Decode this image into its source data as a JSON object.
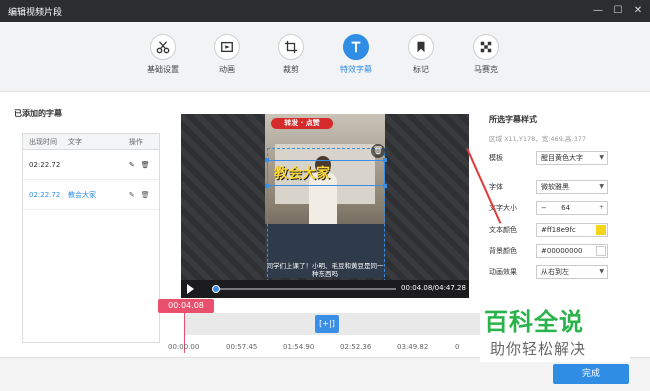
{
  "window": {
    "title": "编辑视频片段",
    "minimize": "—",
    "maximize": "☐",
    "close": "✕"
  },
  "toolbar": {
    "tools": [
      {
        "label": "基础设置",
        "icon": "scissors-icon"
      },
      {
        "label": "动画",
        "icon": "film-icon"
      },
      {
        "label": "裁剪",
        "icon": "crop-icon"
      },
      {
        "label": "特效字幕",
        "icon": "text-t-icon",
        "active": true
      },
      {
        "label": "标记",
        "icon": "bookmark-icon"
      },
      {
        "label": "马赛克",
        "icon": "mosaic-icon"
      }
    ],
    "accent_color": "#2f8de4"
  },
  "subtitles": {
    "title": "已添加的字幕",
    "columns": [
      "出现时间",
      "文字",
      "操作"
    ],
    "rows": [
      {
        "time": "02:22.72",
        "text": "",
        "selected": false
      },
      {
        "time": "02:22.72",
        "text": "教会大家",
        "selected": true
      }
    ]
  },
  "player": {
    "banner": "转发 · 点赞",
    "subtitle": "教会大家",
    "caption": "同学们上课了！小明、毛豆和黄豆是同一种东西吗",
    "time": "00:04.08/04:47.28",
    "progress_fraction": 0.014
  },
  "style_panel": {
    "title": "所选字幕样式",
    "region": "区域 X11,Y178，宽:469,高:377",
    "template_label": "模板",
    "template_value": "醒目黄色大字",
    "font_label": "字体",
    "font_value": "微软雅黑",
    "size_label": "文字大小",
    "size_minus": "−",
    "size_value": "64",
    "size_plus": "+",
    "color_label": "文本颜色",
    "color_value": "#ff18e9fc",
    "color_swatch": "#f5d51c",
    "bg_label": "背景颜色",
    "bg_value": "#00000000",
    "anim_label": "动画效果",
    "anim_value": "从右到左"
  },
  "timeline": {
    "current": "00:04.08",
    "clip_label": "[+|]",
    "ticks": [
      "00:00.00",
      "00:57.45",
      "01:54.90",
      "02:52.36",
      "03:49.82",
      "0"
    ]
  },
  "footer": {
    "finish_label": "完成"
  },
  "watermark": {
    "line1": "百科全说",
    "line2": "助你轻松解决"
  }
}
